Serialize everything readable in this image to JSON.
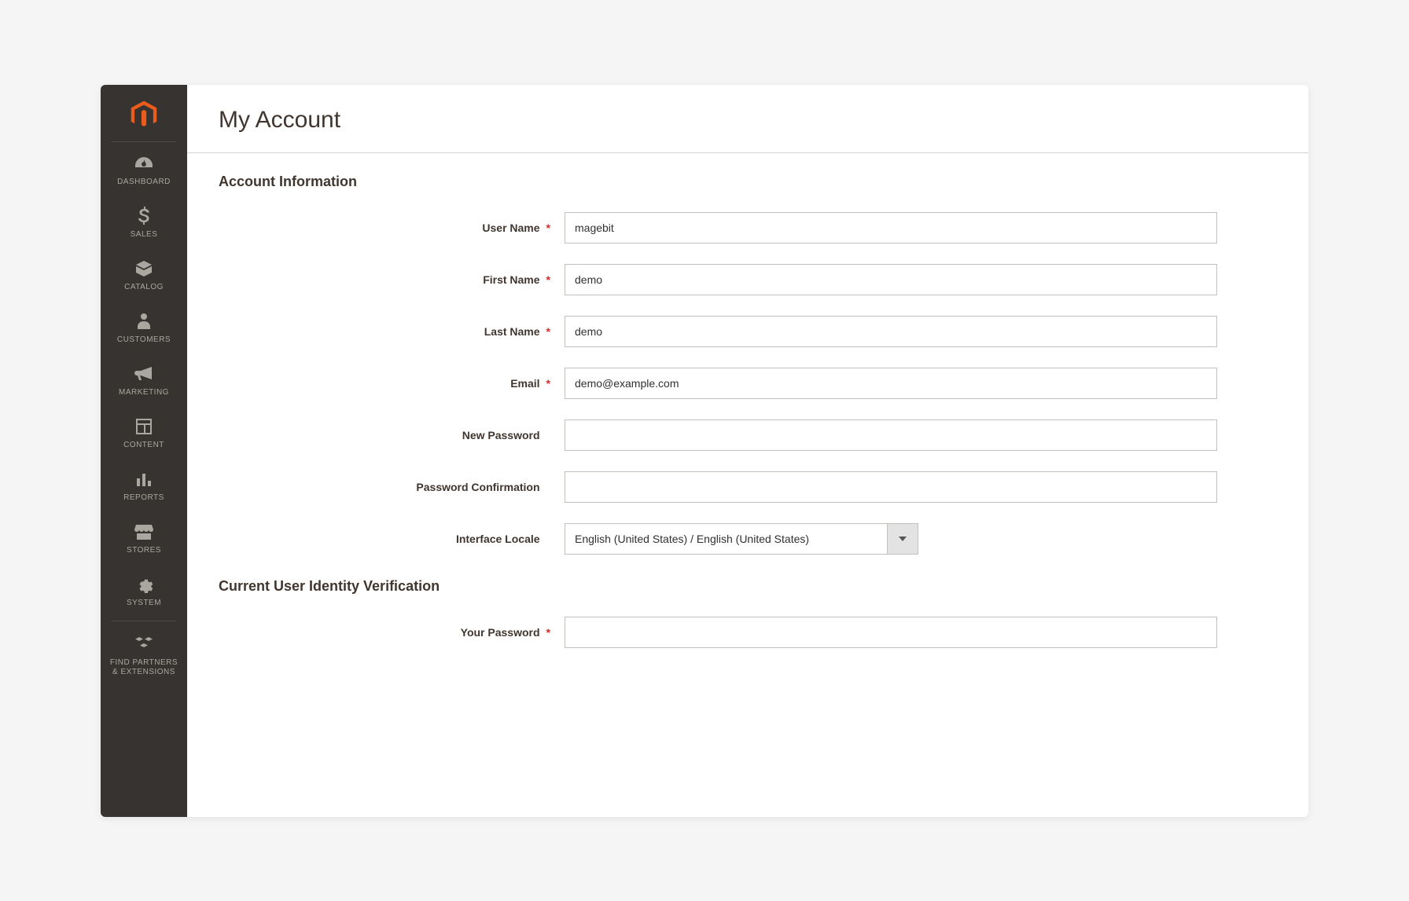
{
  "sidebar": {
    "items": [
      {
        "label": "DASHBOARD",
        "icon": "dashboard"
      },
      {
        "label": "SALES",
        "icon": "sales"
      },
      {
        "label": "CATALOG",
        "icon": "catalog"
      },
      {
        "label": "CUSTOMERS",
        "icon": "customers"
      },
      {
        "label": "MARKETING",
        "icon": "marketing"
      },
      {
        "label": "CONTENT",
        "icon": "content"
      },
      {
        "label": "REPORTS",
        "icon": "reports"
      },
      {
        "label": "STORES",
        "icon": "stores"
      },
      {
        "label": "SYSTEM",
        "icon": "system"
      },
      {
        "label": "FIND PARTNERS\n& EXTENSIONS",
        "icon": "partners"
      }
    ]
  },
  "page": {
    "title": "My Account"
  },
  "account_section": {
    "title": "Account Information",
    "fields": {
      "username": {
        "label": "User Name",
        "value": "magebit",
        "required": true,
        "type": "text"
      },
      "firstname": {
        "label": "First Name",
        "value": "demo",
        "required": true,
        "type": "text"
      },
      "lastname": {
        "label": "Last Name",
        "value": "demo",
        "required": true,
        "type": "text"
      },
      "email": {
        "label": "Email",
        "value": "demo@example.com",
        "required": true,
        "type": "text"
      },
      "newpass": {
        "label": "New Password",
        "value": "",
        "required": false,
        "type": "password"
      },
      "passconf": {
        "label": "Password Confirmation",
        "value": "",
        "required": false,
        "type": "password"
      },
      "locale": {
        "label": "Interface Locale",
        "value": "English (United States) / English (United States)",
        "required": false,
        "type": "select"
      }
    }
  },
  "verify_section": {
    "title": "Current User Identity Verification",
    "fields": {
      "yourpass": {
        "label": "Your Password",
        "value": "",
        "required": true,
        "type": "password"
      }
    }
  },
  "required_marker": "*"
}
